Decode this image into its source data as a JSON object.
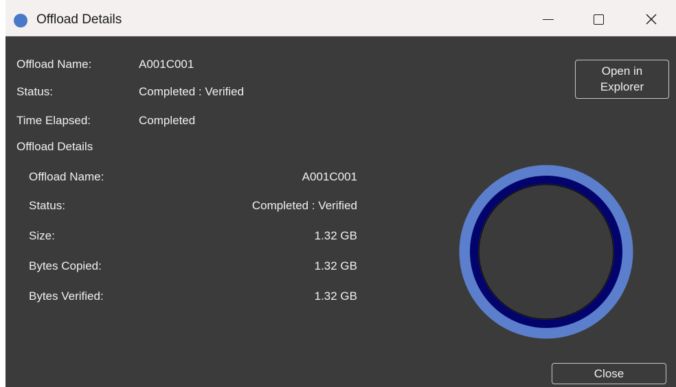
{
  "window": {
    "title": "Offload Details",
    "icon": "app-circle-icon",
    "controls": {
      "minimize": "minimize-icon",
      "maximize": "maximize-icon",
      "close": "close-icon"
    }
  },
  "summary": {
    "offload_name_label": "Offload Name:",
    "offload_name_value": "A001C001",
    "status_label": "Status:",
    "status_value": "Completed : Verified",
    "time_elapsed_label": "Time Elapsed:",
    "time_elapsed_value": "Completed"
  },
  "details": {
    "heading": "Offload Details",
    "rows": [
      {
        "label": "Offload Name:",
        "value": "A001C001"
      },
      {
        "label": "Status:",
        "value": "Completed : Verified"
      },
      {
        "label": "Size:",
        "value": "1.32 GB"
      },
      {
        "label": "Bytes Copied:",
        "value": "1.32 GB"
      },
      {
        "label": "Bytes Verified:",
        "value": "1.32 GB"
      }
    ]
  },
  "buttons": {
    "open_in_explorer_line1": "Open in",
    "open_in_explorer_line2": "Explorer",
    "close": "Close"
  },
  "progress_ring": {
    "outer_progress": 1.0,
    "inner_progress": 1.0,
    "outer_color": "#5b7fcc",
    "inner_color": "#03046b",
    "center_color": "#3b3b3b"
  },
  "colors": {
    "background": "#3b3b3b",
    "titlebar": "#f3f0ef",
    "text": "#f0f0f0",
    "accent": "#4a78c9"
  }
}
